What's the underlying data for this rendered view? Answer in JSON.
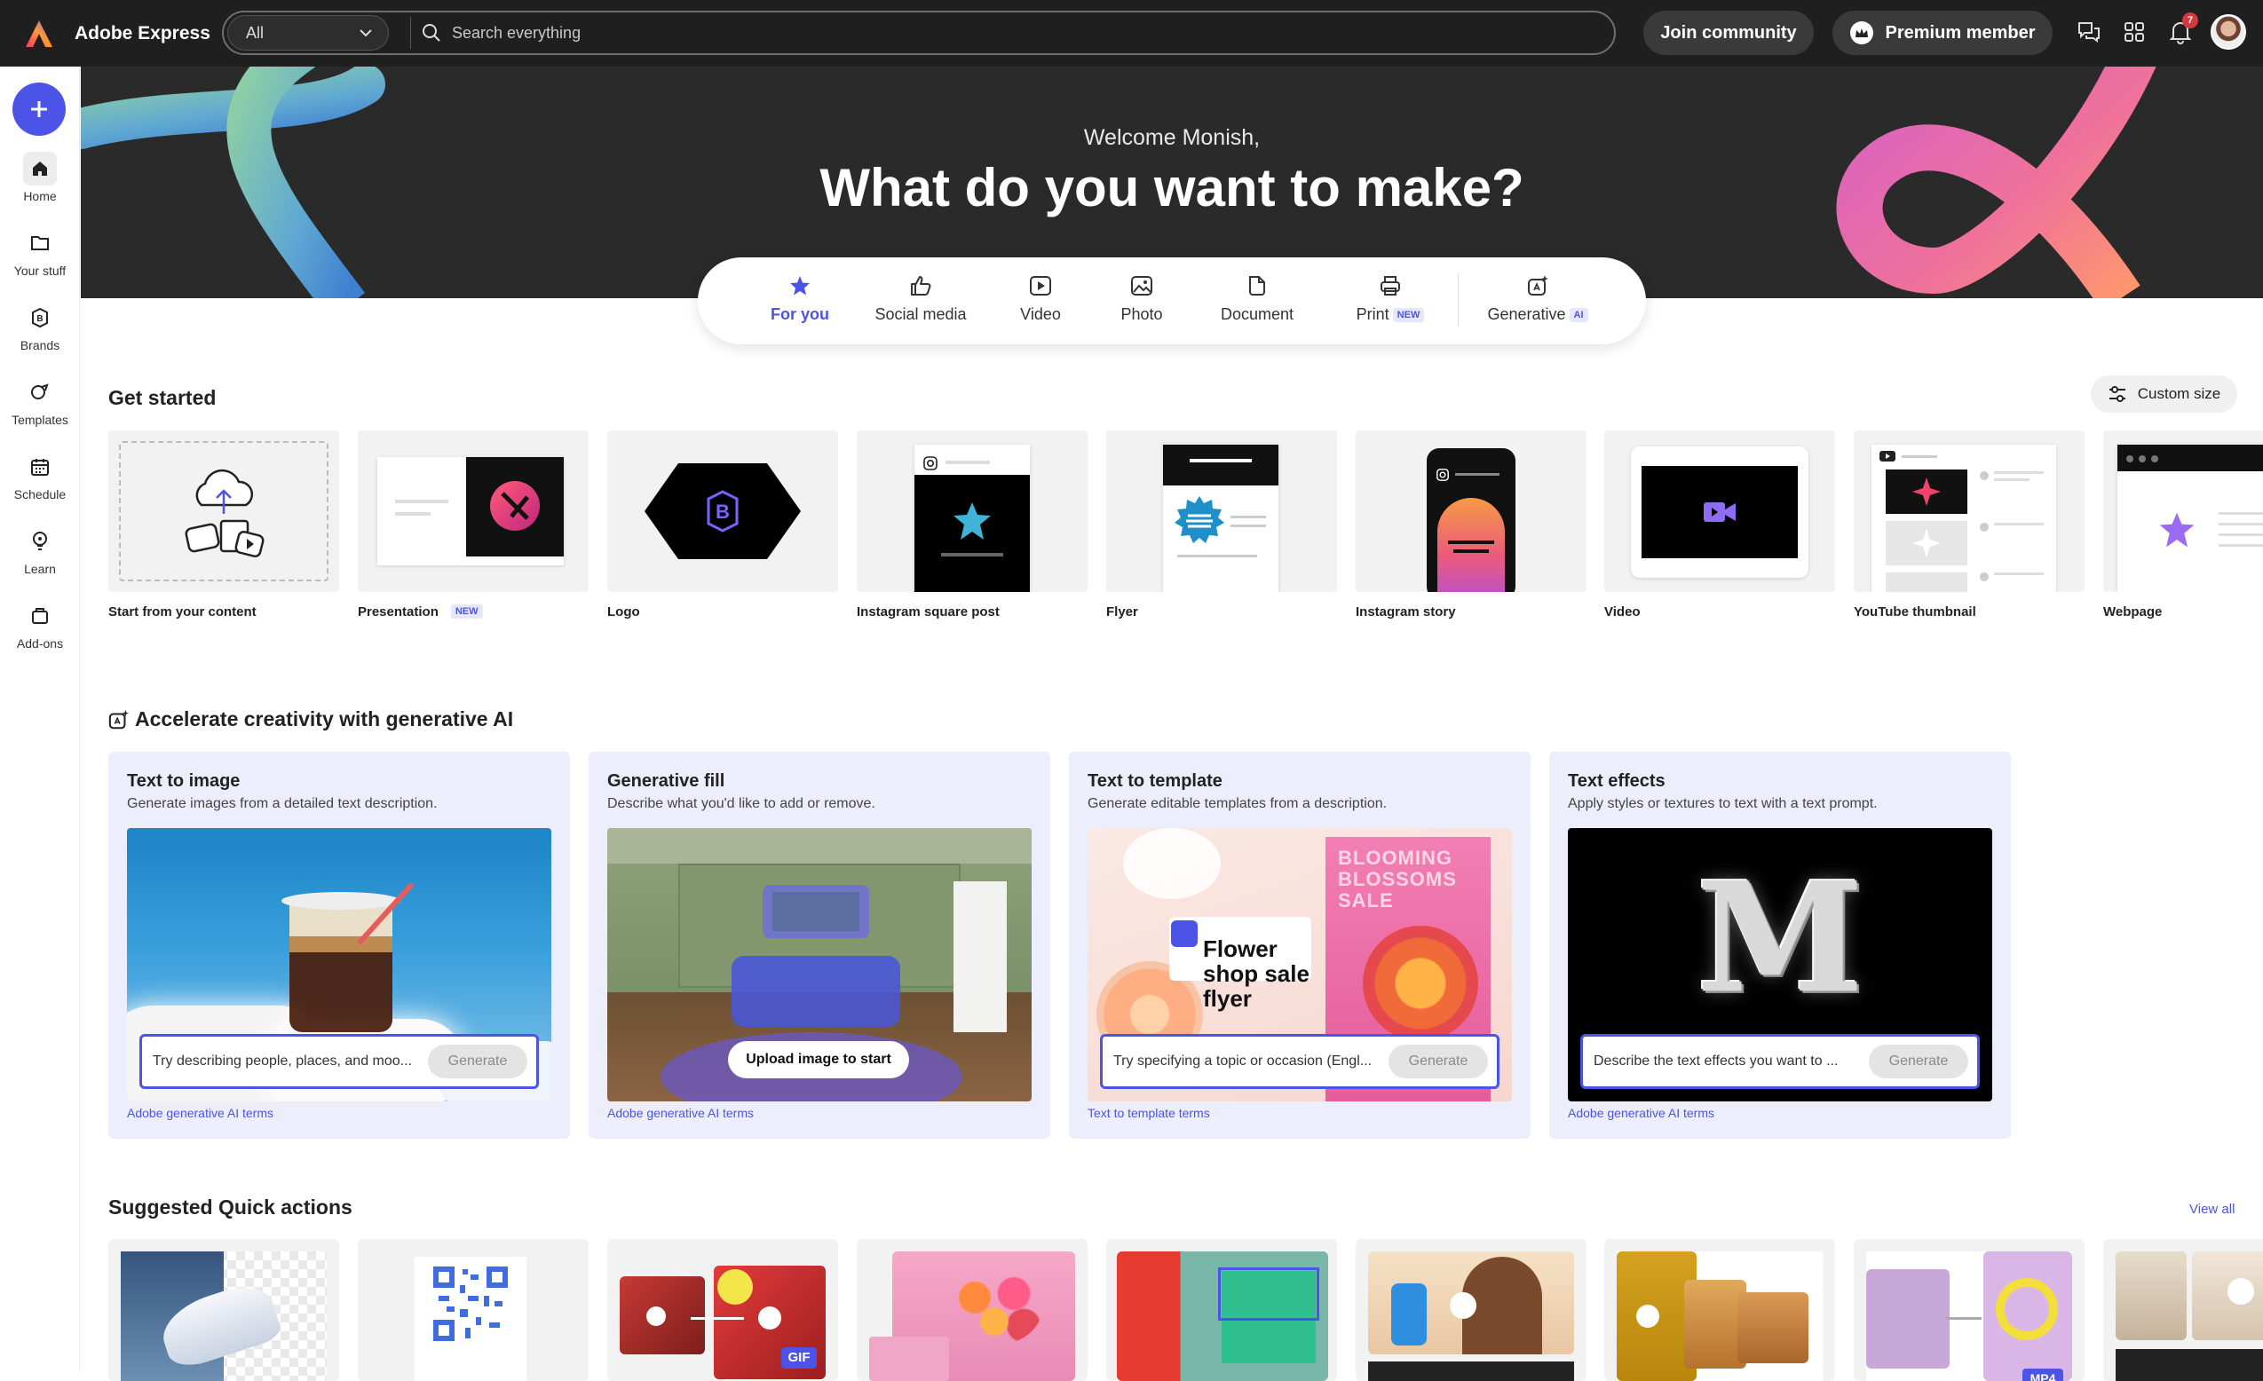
{
  "app": {
    "name": "Adobe Express"
  },
  "search": {
    "scope": "All",
    "placeholder": "Search everything"
  },
  "header": {
    "join": "Join community",
    "premium": "Premium member",
    "notifications": "7"
  },
  "sidebar": {
    "items": [
      {
        "label": "Home",
        "icon": "home-icon"
      },
      {
        "label": "Your stuff",
        "icon": "folder-icon"
      },
      {
        "label": "Brands",
        "icon": "brand-icon"
      },
      {
        "label": "Templates",
        "icon": "templates-icon"
      },
      {
        "label": "Schedule",
        "icon": "calendar-icon"
      },
      {
        "label": "Learn",
        "icon": "lightbulb-icon"
      },
      {
        "label": "Add-ons",
        "icon": "addons-icon"
      }
    ]
  },
  "hero": {
    "welcome": "Welcome Monish,",
    "title": "What do you want to make?"
  },
  "tabs": [
    {
      "label": "For you"
    },
    {
      "label": "Social media"
    },
    {
      "label": "Video"
    },
    {
      "label": "Photo"
    },
    {
      "label": "Document"
    },
    {
      "label": "Print",
      "tag": "NEW"
    },
    {
      "label": "Generative",
      "tag": "AI"
    }
  ],
  "get_started": {
    "title": "Get started",
    "custom_size": "Custom size",
    "cards": [
      {
        "label": "Start from your content"
      },
      {
        "label": "Presentation",
        "tag": "NEW"
      },
      {
        "label": "Logo"
      },
      {
        "label": "Instagram square post"
      },
      {
        "label": "Flyer"
      },
      {
        "label": "Instagram story"
      },
      {
        "label": "Video"
      },
      {
        "label": "YouTube thumbnail"
      },
      {
        "label": "Webpage"
      }
    ]
  },
  "ai": {
    "title": "Accelerate creativity with generative AI",
    "cards": [
      {
        "title": "Text to image",
        "desc": "Generate images from a detailed text description.",
        "placeholder": "Try describing people, places, and moo...",
        "button": "Generate",
        "link": "Adobe generative AI terms"
      },
      {
        "title": "Generative fill",
        "desc": "Describe what you'd like to add or remove.",
        "button": "Upload image to start",
        "link": "Adobe generative AI terms"
      },
      {
        "title": "Text to template",
        "desc": "Generate editable templates from a description.",
        "placeholder": "Try specifying a topic or occasion (Engl...",
        "button": "Generate",
        "link": "Text to template terms",
        "img_text_main": "Flower shop sale flyer",
        "img_text_poster": "BLOOMING BLOSSOMS SALE"
      },
      {
        "title": "Text effects",
        "desc": "Apply styles or textures to text with a text prompt.",
        "placeholder": "Describe the text effects you want to ...",
        "button": "Generate",
        "link": "Adobe generative AI terms",
        "img_letter": "M"
      }
    ]
  },
  "quick": {
    "title": "Suggested Quick actions",
    "view_all": "View all",
    "gif": "GIF",
    "mp4": "MP4"
  }
}
